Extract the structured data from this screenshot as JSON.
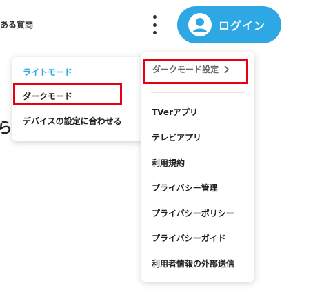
{
  "header": {
    "partial_text": "ある質問",
    "login_label": "ログイン",
    "menu_icon": "kebab-vertical-icon",
    "avatar_icon": "user-avatar-icon"
  },
  "background": {
    "partial_text": "ら"
  },
  "theme_menu": {
    "items": [
      {
        "label": "ライトモード",
        "selected": true
      },
      {
        "label": "ダークモード"
      },
      {
        "label": "デバイスの設定に合わせる"
      }
    ]
  },
  "more_menu": {
    "dark_mode_setting": "ダークモード設定",
    "items": [
      {
        "label": "TVerアプリ"
      },
      {
        "label": "テレビアプリ"
      },
      {
        "label": "利用規約"
      },
      {
        "label": "プライバシー管理"
      },
      {
        "label": "プライバシーポリシー"
      },
      {
        "label": "プライバシーガイド"
      },
      {
        "label": "利用者情報の外部送信"
      }
    ]
  },
  "colors": {
    "accent": "#2ea8e5",
    "highlight": "#e60012",
    "text": "#222222"
  }
}
